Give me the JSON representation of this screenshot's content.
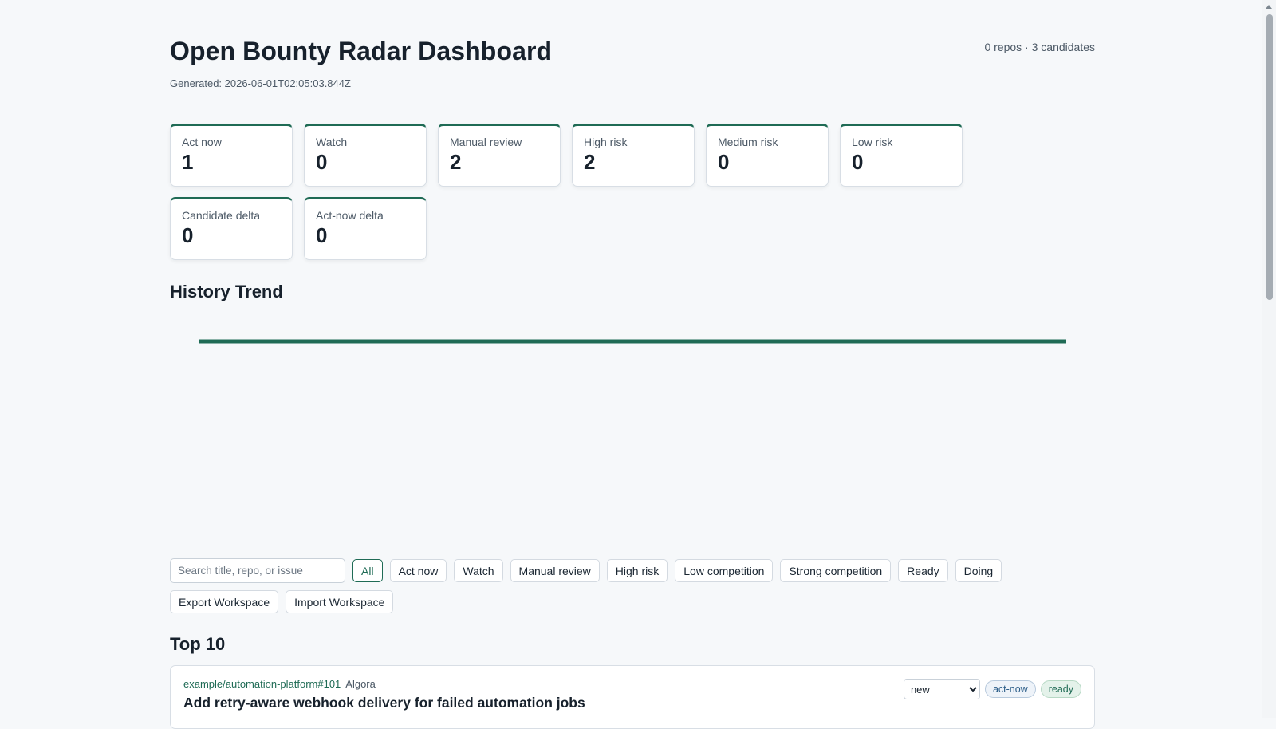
{
  "header": {
    "title": "Open Bounty Radar Dashboard",
    "generated": "Generated: 2026-06-01T02:05:03.844Z",
    "summary": "0 repos · 3 candidates"
  },
  "stats": [
    {
      "label": "Act now",
      "value": "1"
    },
    {
      "label": "Watch",
      "value": "0"
    },
    {
      "label": "Manual review",
      "value": "2"
    },
    {
      "label": "High risk",
      "value": "2"
    },
    {
      "label": "Medium risk",
      "value": "0"
    },
    {
      "label": "Low risk",
      "value": "0"
    },
    {
      "label": "Candidate delta",
      "value": "0"
    },
    {
      "label": "Act-now delta",
      "value": "0"
    }
  ],
  "history": {
    "title": "History Trend",
    "line_color": "#1f6b55"
  },
  "filters": {
    "search_placeholder": "Search title, repo, or issue",
    "buttons": [
      "All",
      "Act now",
      "Watch",
      "Manual review",
      "High risk",
      "Low competition",
      "Strong competition",
      "Ready",
      "Doing",
      "Export Workspace",
      "Import Workspace"
    ],
    "active": "All"
  },
  "top": {
    "title": "Top 10",
    "items": [
      {
        "repo": "example/automation-platform#101",
        "platform": "Algora",
        "title": "Add retry-aware webhook delivery for failed automation jobs",
        "status": "new",
        "priority": "act-now",
        "readiness": "ready"
      }
    ]
  },
  "colors": {
    "accent": "#1f6b55",
    "background": "#f6f8fa"
  }
}
